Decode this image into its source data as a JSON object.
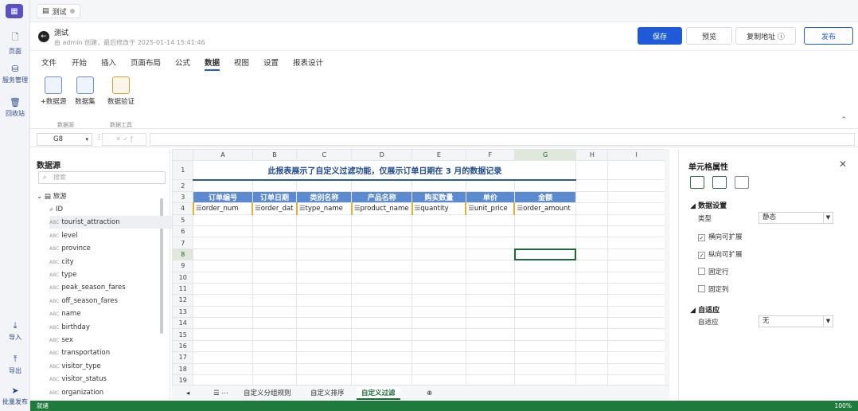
{
  "app": {
    "tab_title": "测试",
    "rail": [
      "页面",
      "服务管理",
      "回收站",
      "导入",
      "导出",
      "批量发布"
    ]
  },
  "titlebar": {
    "title": "测试",
    "meta": "由 admin 创建，最后修改于 2025-01-14 15:41:46",
    "save": "保存",
    "preview": "预览",
    "copy": "复制地址 ⓘ",
    "publish": "发布"
  },
  "menu": [
    "文件",
    "开始",
    "插入",
    "页面布局",
    "公式",
    "数据",
    "视图",
    "设置",
    "报表设计"
  ],
  "ribbon": {
    "buttons": [
      "+数据源",
      "数据集",
      "数据验证"
    ],
    "groups": [
      "数据源",
      "数据工具"
    ]
  },
  "formula": {
    "cellref": "G8"
  },
  "datasource": {
    "title": "数据源",
    "search_placeholder": "搜索",
    "tree_root": "旅游",
    "fields": [
      "ID",
      "tourist_attraction",
      "level",
      "province",
      "city",
      "type",
      "peak_season_fares",
      "off_season_fares",
      "name",
      "birthday",
      "sex",
      "transportation",
      "visitor_type",
      "visitor_status",
      "organization"
    ],
    "field_tags": [
      "#",
      "ABC",
      "ABC",
      "ABC",
      "ABC",
      "ABC",
      "ABC",
      "ABC",
      "ABC",
      "ABC",
      "ABC",
      "ABC",
      "ABC",
      "ABC",
      "ABC"
    ]
  },
  "grid": {
    "columns": [
      "A",
      "B",
      "C",
      "D",
      "E",
      "F",
      "G",
      "H",
      "I"
    ],
    "rows": [
      "1",
      "2",
      "3",
      "4",
      "5",
      "6",
      "7",
      "8",
      "9",
      "10",
      "11",
      "12",
      "13",
      "14",
      "15",
      "16",
      "17",
      "18",
      "19"
    ],
    "title": "此报表展示了自定义过滤功能，仅展示订单日期在 3 月的数据记录",
    "headers": [
      "订单编号",
      "订单日期",
      "类别名称",
      "产品名称",
      "购买数量",
      "单价",
      "金额"
    ],
    "fields": [
      "order_num",
      "order_dat",
      "type_name",
      "product_name",
      "quantity",
      "unit_price",
      "order_amount"
    ]
  },
  "sheets": [
    "自定义分组规则",
    "自定义排序",
    "自定义过滤"
  ],
  "props": {
    "title": "单元格属性",
    "section1": "数据设置",
    "type_label": "类型",
    "type_value": "静态",
    "checks": [
      "横向可扩展",
      "纵向可扩展",
      "固定行",
      "固定列"
    ],
    "checked": [
      true,
      true,
      false,
      false
    ],
    "section2": "自适应",
    "adapt_label": "自适应",
    "adapt_value": "无"
  },
  "status": {
    "text": "就绪",
    "zoom": "100%"
  }
}
